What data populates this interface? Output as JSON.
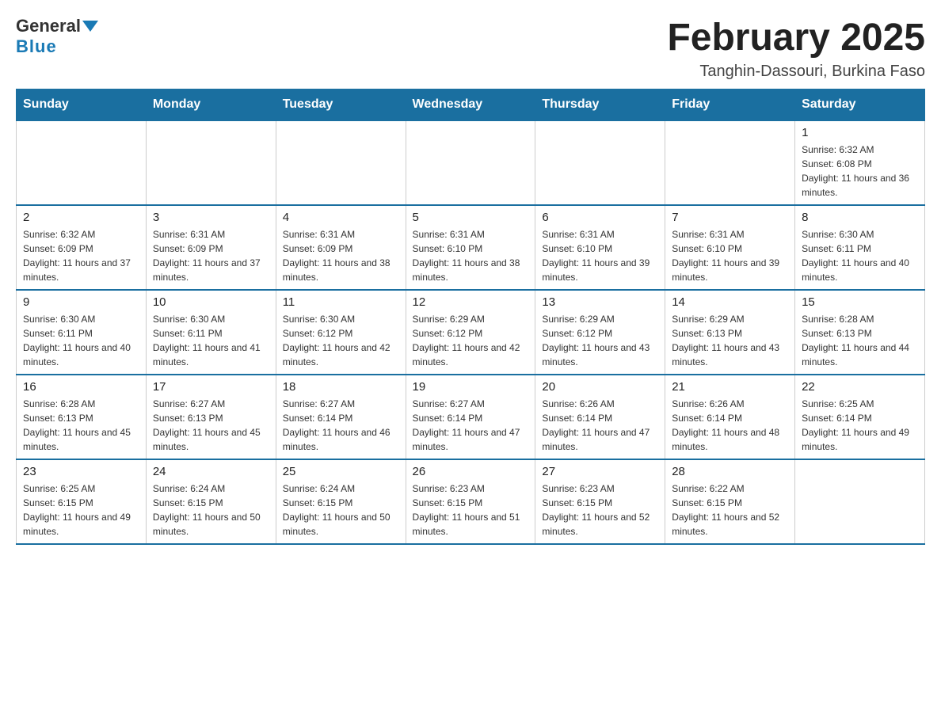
{
  "header": {
    "logo_general": "General",
    "logo_blue": "Blue",
    "month_title": "February 2025",
    "location": "Tanghin-Dassouri, Burkina Faso"
  },
  "days_of_week": [
    "Sunday",
    "Monday",
    "Tuesday",
    "Wednesday",
    "Thursday",
    "Friday",
    "Saturday"
  ],
  "weeks": [
    [
      {
        "day": "",
        "info": ""
      },
      {
        "day": "",
        "info": ""
      },
      {
        "day": "",
        "info": ""
      },
      {
        "day": "",
        "info": ""
      },
      {
        "day": "",
        "info": ""
      },
      {
        "day": "",
        "info": ""
      },
      {
        "day": "1",
        "info": "Sunrise: 6:32 AM\nSunset: 6:08 PM\nDaylight: 11 hours and 36 minutes."
      }
    ],
    [
      {
        "day": "2",
        "info": "Sunrise: 6:32 AM\nSunset: 6:09 PM\nDaylight: 11 hours and 37 minutes."
      },
      {
        "day": "3",
        "info": "Sunrise: 6:31 AM\nSunset: 6:09 PM\nDaylight: 11 hours and 37 minutes."
      },
      {
        "day": "4",
        "info": "Sunrise: 6:31 AM\nSunset: 6:09 PM\nDaylight: 11 hours and 38 minutes."
      },
      {
        "day": "5",
        "info": "Sunrise: 6:31 AM\nSunset: 6:10 PM\nDaylight: 11 hours and 38 minutes."
      },
      {
        "day": "6",
        "info": "Sunrise: 6:31 AM\nSunset: 6:10 PM\nDaylight: 11 hours and 39 minutes."
      },
      {
        "day": "7",
        "info": "Sunrise: 6:31 AM\nSunset: 6:10 PM\nDaylight: 11 hours and 39 minutes."
      },
      {
        "day": "8",
        "info": "Sunrise: 6:30 AM\nSunset: 6:11 PM\nDaylight: 11 hours and 40 minutes."
      }
    ],
    [
      {
        "day": "9",
        "info": "Sunrise: 6:30 AM\nSunset: 6:11 PM\nDaylight: 11 hours and 40 minutes."
      },
      {
        "day": "10",
        "info": "Sunrise: 6:30 AM\nSunset: 6:11 PM\nDaylight: 11 hours and 41 minutes."
      },
      {
        "day": "11",
        "info": "Sunrise: 6:30 AM\nSunset: 6:12 PM\nDaylight: 11 hours and 42 minutes."
      },
      {
        "day": "12",
        "info": "Sunrise: 6:29 AM\nSunset: 6:12 PM\nDaylight: 11 hours and 42 minutes."
      },
      {
        "day": "13",
        "info": "Sunrise: 6:29 AM\nSunset: 6:12 PM\nDaylight: 11 hours and 43 minutes."
      },
      {
        "day": "14",
        "info": "Sunrise: 6:29 AM\nSunset: 6:13 PM\nDaylight: 11 hours and 43 minutes."
      },
      {
        "day": "15",
        "info": "Sunrise: 6:28 AM\nSunset: 6:13 PM\nDaylight: 11 hours and 44 minutes."
      }
    ],
    [
      {
        "day": "16",
        "info": "Sunrise: 6:28 AM\nSunset: 6:13 PM\nDaylight: 11 hours and 45 minutes."
      },
      {
        "day": "17",
        "info": "Sunrise: 6:27 AM\nSunset: 6:13 PM\nDaylight: 11 hours and 45 minutes."
      },
      {
        "day": "18",
        "info": "Sunrise: 6:27 AM\nSunset: 6:14 PM\nDaylight: 11 hours and 46 minutes."
      },
      {
        "day": "19",
        "info": "Sunrise: 6:27 AM\nSunset: 6:14 PM\nDaylight: 11 hours and 47 minutes."
      },
      {
        "day": "20",
        "info": "Sunrise: 6:26 AM\nSunset: 6:14 PM\nDaylight: 11 hours and 47 minutes."
      },
      {
        "day": "21",
        "info": "Sunrise: 6:26 AM\nSunset: 6:14 PM\nDaylight: 11 hours and 48 minutes."
      },
      {
        "day": "22",
        "info": "Sunrise: 6:25 AM\nSunset: 6:14 PM\nDaylight: 11 hours and 49 minutes."
      }
    ],
    [
      {
        "day": "23",
        "info": "Sunrise: 6:25 AM\nSunset: 6:15 PM\nDaylight: 11 hours and 49 minutes."
      },
      {
        "day": "24",
        "info": "Sunrise: 6:24 AM\nSunset: 6:15 PM\nDaylight: 11 hours and 50 minutes."
      },
      {
        "day": "25",
        "info": "Sunrise: 6:24 AM\nSunset: 6:15 PM\nDaylight: 11 hours and 50 minutes."
      },
      {
        "day": "26",
        "info": "Sunrise: 6:23 AM\nSunset: 6:15 PM\nDaylight: 11 hours and 51 minutes."
      },
      {
        "day": "27",
        "info": "Sunrise: 6:23 AM\nSunset: 6:15 PM\nDaylight: 11 hours and 52 minutes."
      },
      {
        "day": "28",
        "info": "Sunrise: 6:22 AM\nSunset: 6:15 PM\nDaylight: 11 hours and 52 minutes."
      },
      {
        "day": "",
        "info": ""
      }
    ]
  ]
}
